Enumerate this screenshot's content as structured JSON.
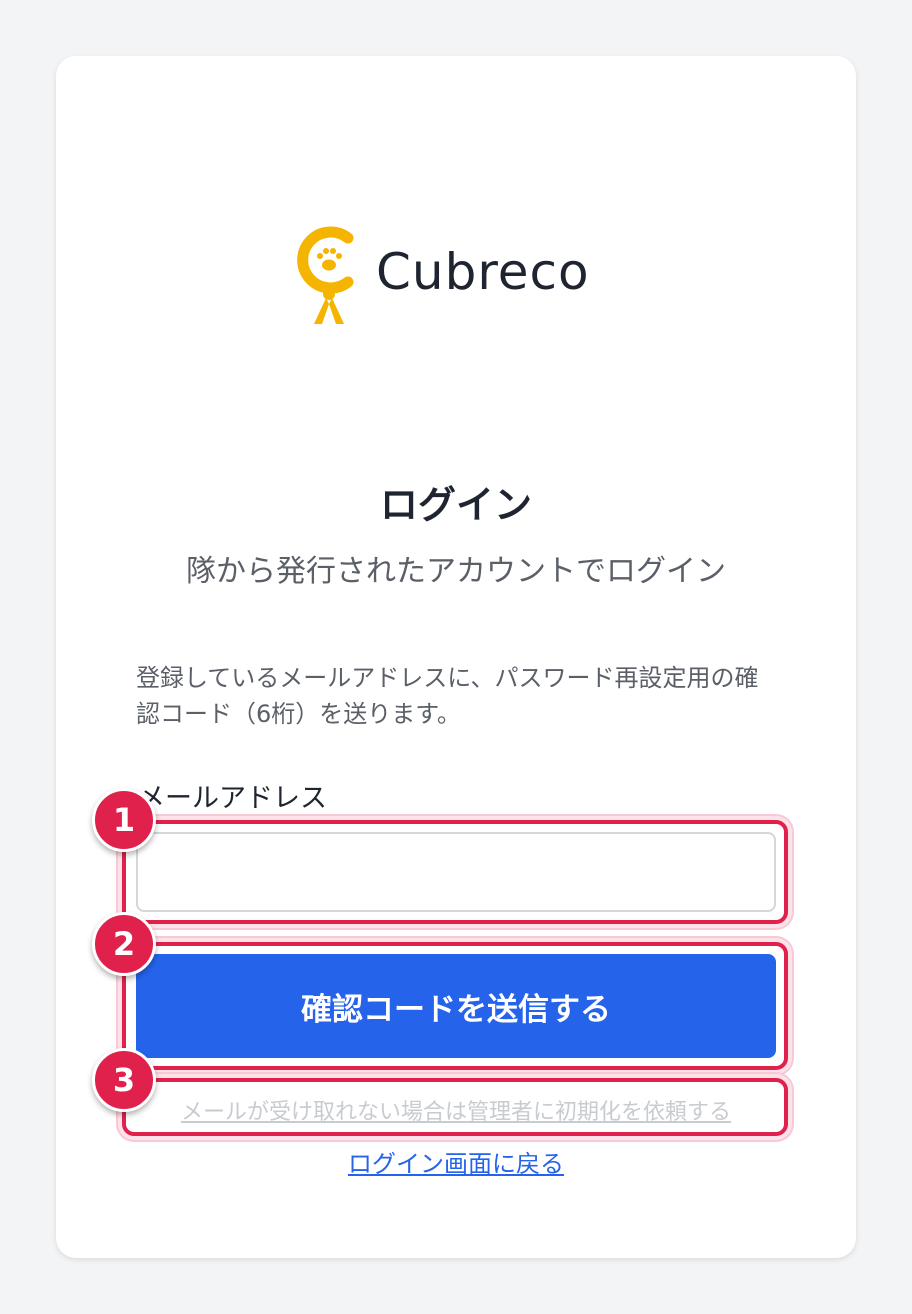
{
  "brand": {
    "name": "Cubreco",
    "icon": "scout-paw-logo-icon",
    "accent": "#f5b400"
  },
  "page": {
    "title": "ログイン",
    "subtitle": "隊から発行されたアカウントでログイン",
    "description": "登録しているメールアドレスに、パスワード再設定用の確認コード（6桁）を送ります。"
  },
  "form": {
    "email_label": "メールアドレス",
    "email_value": "",
    "email_placeholder": "",
    "submit_label": "確認コードを送信する"
  },
  "links": {
    "help": "メールが受け取れない場合は管理者に初期化を依頼する",
    "back": "ログイン画面に戻る"
  },
  "annotations": {
    "markers": [
      "1",
      "2",
      "3"
    ],
    "color": "#e0214c"
  },
  "colors": {
    "primary": "#2563eb",
    "background": "#f3f4f6",
    "card": "#ffffff"
  }
}
